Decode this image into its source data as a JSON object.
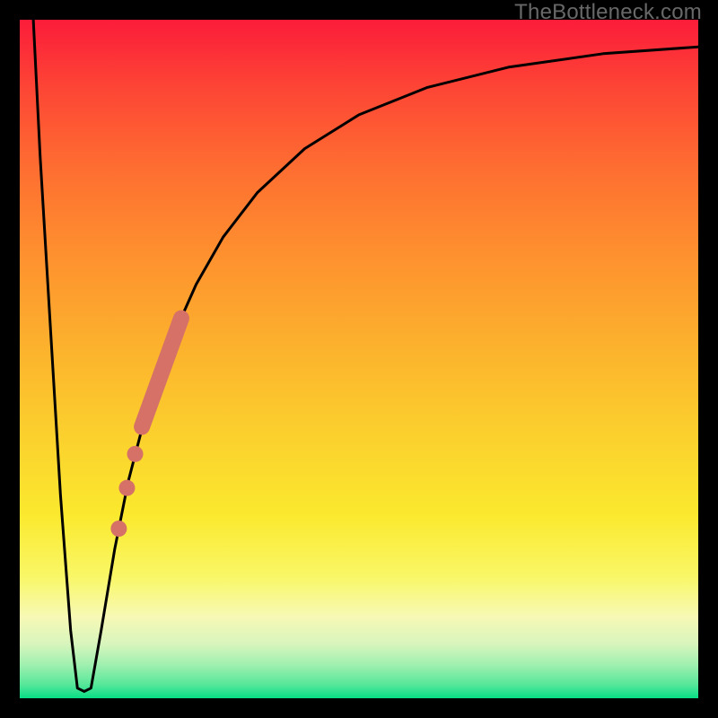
{
  "watermark": "TheBottleneck.com",
  "chart_data": {
    "type": "line",
    "title": "",
    "xlabel": "",
    "ylabel": "",
    "xlim": [
      0,
      100
    ],
    "ylim": [
      0,
      100
    ],
    "grid": false,
    "legend": false,
    "background": {
      "type": "vertical-gradient",
      "stops": [
        {
          "pos": 0,
          "color": "#fc1c3a"
        },
        {
          "pos": 10,
          "color": "#fd4535"
        },
        {
          "pos": 22,
          "color": "#fe6e31"
        },
        {
          "pos": 34,
          "color": "#fe8f2f"
        },
        {
          "pos": 48,
          "color": "#fcb12d"
        },
        {
          "pos": 62,
          "color": "#fbd22d"
        },
        {
          "pos": 73,
          "color": "#fbe92e"
        },
        {
          "pos": 82,
          "color": "#f9f766"
        },
        {
          "pos": 88,
          "color": "#f7f9b5"
        },
        {
          "pos": 92,
          "color": "#d8f5bd"
        },
        {
          "pos": 95,
          "color": "#a1f0b0"
        },
        {
          "pos": 98,
          "color": "#56e79a"
        },
        {
          "pos": 100,
          "color": "#08dd85"
        }
      ]
    },
    "series": [
      {
        "name": "curve",
        "color": "#000000",
        "values": [
          {
            "x": 2.0,
            "y": 100.0
          },
          {
            "x": 3.0,
            "y": 80.0
          },
          {
            "x": 4.5,
            "y": 55.0
          },
          {
            "x": 6.0,
            "y": 30.0
          },
          {
            "x": 7.5,
            "y": 10.0
          },
          {
            "x": 8.5,
            "y": 1.5
          },
          {
            "x": 9.5,
            "y": 1.0
          },
          {
            "x": 10.5,
            "y": 1.5
          },
          {
            "x": 12.0,
            "y": 10.0
          },
          {
            "x": 14.0,
            "y": 22.0
          },
          {
            "x": 16.0,
            "y": 32.0
          },
          {
            "x": 19.0,
            "y": 43.5
          },
          {
            "x": 22.0,
            "y": 52.0
          },
          {
            "x": 26.0,
            "y": 61.0
          },
          {
            "x": 30.0,
            "y": 68.0
          },
          {
            "x": 35.0,
            "y": 74.5
          },
          {
            "x": 42.0,
            "y": 81.0
          },
          {
            "x": 50.0,
            "y": 86.0
          },
          {
            "x": 60.0,
            "y": 90.0
          },
          {
            "x": 72.0,
            "y": 93.0
          },
          {
            "x": 86.0,
            "y": 95.0
          },
          {
            "x": 100.0,
            "y": 96.0
          }
        ]
      }
    ],
    "highlights": {
      "thick_segment": {
        "color": "#d57167",
        "start": {
          "x": 18.0,
          "y": 40.0
        },
        "end": {
          "x": 23.8,
          "y": 56.0
        }
      },
      "dots": [
        {
          "x": 17.0,
          "y": 36.0
        },
        {
          "x": 15.8,
          "y": 31.0
        },
        {
          "x": 14.6,
          "y": 25.0
        }
      ],
      "dot_radius_px": 9,
      "dot_color": "#d57167"
    }
  }
}
